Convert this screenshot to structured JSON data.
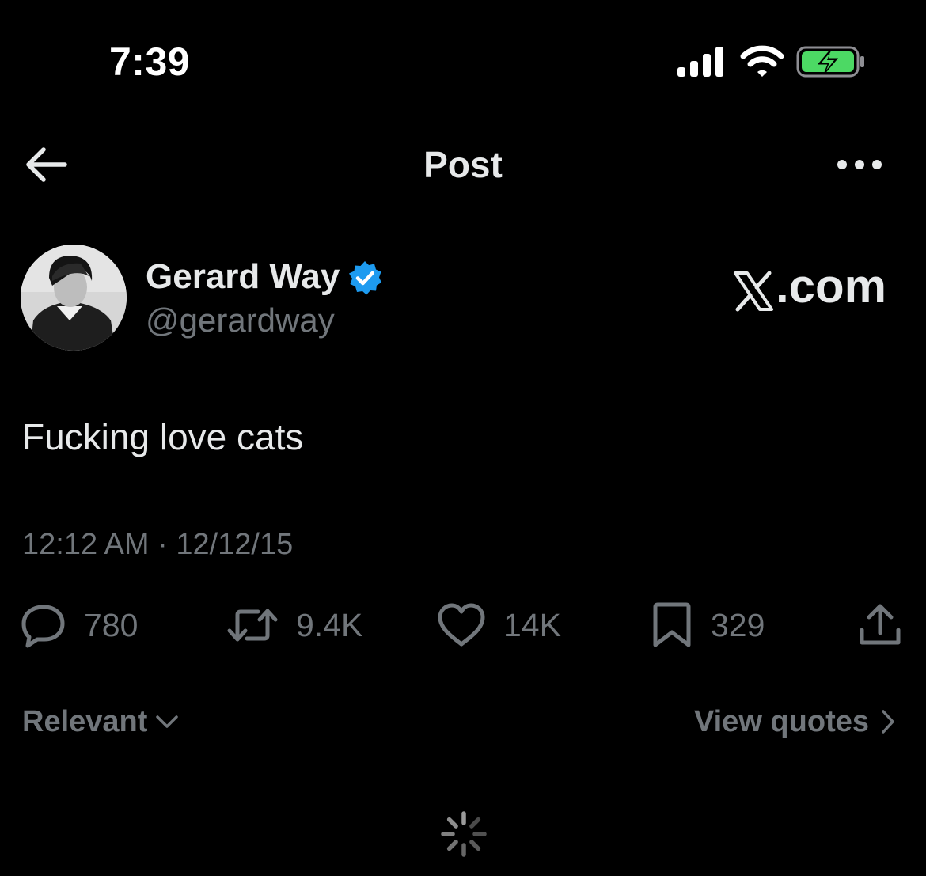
{
  "status_bar": {
    "time": "7:39",
    "icons": [
      "cellular-signal-icon",
      "wifi-icon",
      "battery-charging-icon"
    ],
    "battery_color": "#4cd964"
  },
  "header": {
    "title": "Post",
    "back_icon": "arrow-left-icon",
    "more_icon": "more-horizontal-icon"
  },
  "author": {
    "name": "Gerard Way",
    "handle": "@gerardway",
    "verified_icon": "verified-badge-icon",
    "verified_color": "#1d9bf0"
  },
  "watermark": {
    "text": ".com",
    "logo_icon": "x-logo-icon"
  },
  "post": {
    "text": "Fucking love cats",
    "meta": "12:12 AM · 12/12/15"
  },
  "actions": {
    "replies": "780",
    "reposts": "9.4K",
    "likes": "14K",
    "bookmarks": "329",
    "icons": [
      "reply-icon",
      "repost-icon",
      "like-icon",
      "bookmark-icon",
      "share-icon"
    ]
  },
  "footer": {
    "sort_label": "Relevant",
    "quotes_label": "View quotes"
  },
  "colors": {
    "background": "#000000",
    "primary_text": "#e7e9ea",
    "secondary_text": "#71767b"
  }
}
